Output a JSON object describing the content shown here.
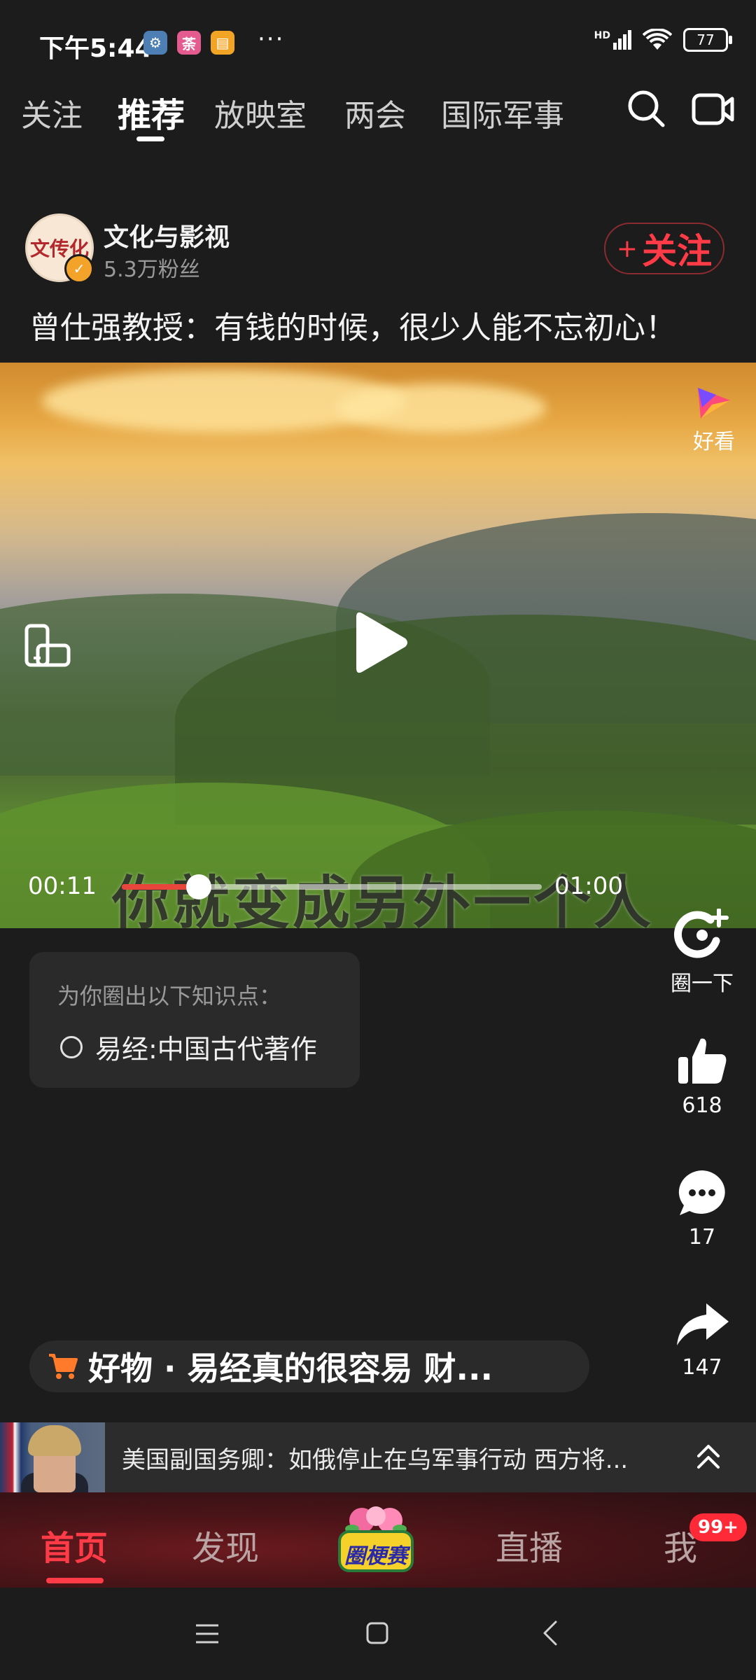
{
  "status_bar": {
    "time": "下午5:44",
    "more": "···",
    "network": "HD",
    "battery": "77",
    "app_icons": [
      {
        "name": "settings-gear",
        "glyph": "⚙",
        "color": "#4e7fb4"
      },
      {
        "name": "pink-app",
        "glyph": "荼",
        "color": "#e45b8f"
      },
      {
        "name": "message-app",
        "glyph": "▤",
        "color": "#f2a425"
      }
    ]
  },
  "top_tabs": {
    "items": [
      "关注",
      "推荐",
      "放映室",
      "两会",
      "国际军事"
    ],
    "active": "推荐"
  },
  "author": {
    "avatar_text": "文传化",
    "name": "文化与影视",
    "fans": "5.3万粉丝",
    "follow_label": "关注",
    "follow_plus": "+"
  },
  "video": {
    "title": "曾仕强教授：有钱的时候，很少人能不忘初心！",
    "brand_label": "好看",
    "subtitle": "你就变成另外一个人",
    "current_time": "00:11",
    "total_time": "01:00",
    "progress": 0.183
  },
  "actions": {
    "circle_label": "圈一下",
    "likes": "618",
    "comments": "17",
    "shares": "147"
  },
  "knowledge": {
    "title": "为你圈出以下知识点：",
    "items": [
      "易经:中国古代著作"
    ]
  },
  "product": {
    "text": "好物 · 易经真的很容易 财..."
  },
  "news": {
    "text": "美国副国务卿：如俄停止在乌军事行动 西方将..."
  },
  "bottom_nav": {
    "items": [
      "首页",
      "发现",
      "直播",
      "我"
    ],
    "center_label": "圈梗赛",
    "active": "首页",
    "badge": "99+"
  },
  "colors": {
    "accent": "#ff3b47",
    "background": "#1c1c1c",
    "card": "#2a2a2a"
  }
}
